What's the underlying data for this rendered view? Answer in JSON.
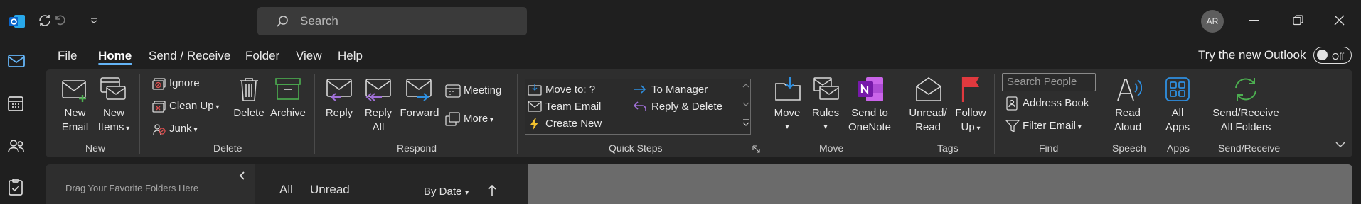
{
  "titlebar": {
    "search_placeholder": "Search",
    "avatar_initials": "AR"
  },
  "menu": {
    "items": [
      "File",
      "Home",
      "Send / Receive",
      "Folder",
      "View",
      "Help"
    ],
    "active": "Home",
    "try_new_outlook": "Try the new Outlook",
    "toggle_label": "Off"
  },
  "ribbon": {
    "new": {
      "new_email": [
        "New",
        "Email"
      ],
      "new_items": [
        "New",
        "Items"
      ],
      "group": "New"
    },
    "delete": {
      "ignore": "Ignore",
      "clean_up": "Clean Up",
      "junk": "Junk",
      "delete": "Delete",
      "archive": "Archive",
      "group": "Delete"
    },
    "respond": {
      "reply": "Reply",
      "reply_all": [
        "Reply",
        "All"
      ],
      "forward": "Forward",
      "meeting": "Meeting",
      "more": "More",
      "group": "Respond"
    },
    "quick_steps": {
      "items": [
        "Move to: ?",
        "Team Email",
        "Create New",
        "To Manager",
        "Reply & Delete"
      ],
      "group": "Quick Steps"
    },
    "move": {
      "move": "Move",
      "rules": "Rules",
      "send_onenote": [
        "Send to",
        "OneNote"
      ],
      "group": "Move"
    },
    "tags": {
      "unread_read": [
        "Unread/",
        "Read"
      ],
      "follow_up": [
        "Follow",
        "Up"
      ],
      "group": "Tags"
    },
    "find": {
      "search_people_placeholder": "Search People",
      "address_book": "Address Book",
      "filter_email": "Filter Email",
      "group": "Find"
    },
    "speech": {
      "read_aloud": [
        "Read",
        "Aloud"
      ],
      "group": "Speech"
    },
    "apps": {
      "all_apps": [
        "All",
        "Apps"
      ],
      "group": "Apps"
    },
    "send_receive": {
      "send_receive_all": [
        "Send/Receive",
        "All Folders"
      ],
      "group": "Send/Receive"
    }
  },
  "folder_pane": {
    "drag_text": "Drag Your Favorite Folders Here"
  },
  "message_list": {
    "tabs": [
      "All",
      "Unread"
    ],
    "sort": "By Date"
  },
  "colors": {
    "accent": "#64b4f6",
    "onenote": "#7719aa",
    "flag": "#e0393e",
    "quickstep_yellow": "#f2c12e"
  }
}
